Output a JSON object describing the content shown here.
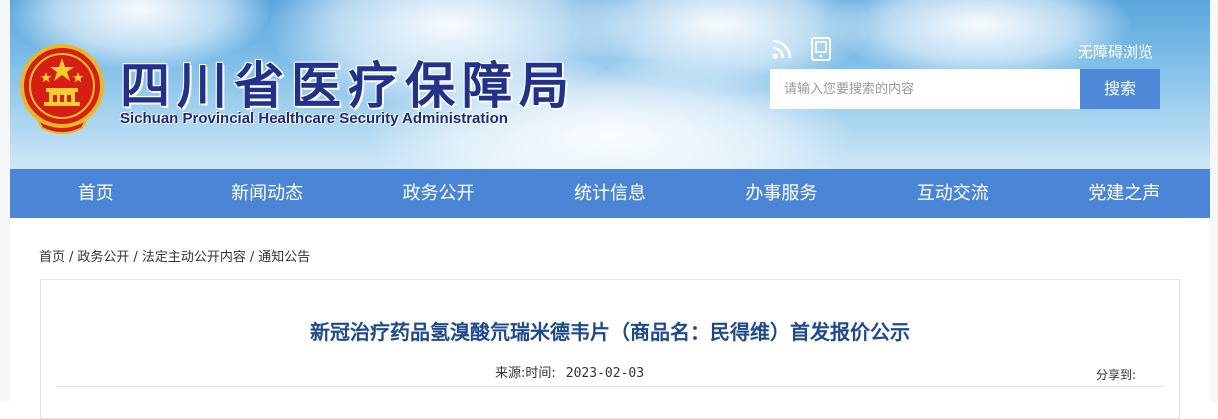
{
  "header": {
    "title_cn": "四川省医疗保障局",
    "title_en": "Sichuan Provincial Healthcare Security Administration",
    "accessible_label": "无障碍浏览",
    "icons": [
      "rss-icon",
      "mobile-icon"
    ]
  },
  "search": {
    "placeholder": "请输入您要搜索的内容",
    "button_label": "搜索"
  },
  "nav": {
    "items": [
      "首页",
      "新闻动态",
      "政务公开",
      "统计信息",
      "办事服务",
      "互动交流",
      "党建之声"
    ]
  },
  "breadcrumb": {
    "items": [
      "首页",
      "政务公开",
      "法定主动公开内容",
      "通知公告"
    ],
    "separator": "/"
  },
  "article": {
    "title": "新冠治疗药品氢溴酸氘瑞米德韦片（商品名：民得维）首发报价公示",
    "source_label": "来源:",
    "time_label": "时间:",
    "date": "2023-02-03",
    "share_label": "分享到:"
  },
  "colors": {
    "nav_bg": "#4b86d6",
    "search_button": "#4f8ad9",
    "title_blue": "#22318a",
    "article_title": "#1f4a8c"
  }
}
